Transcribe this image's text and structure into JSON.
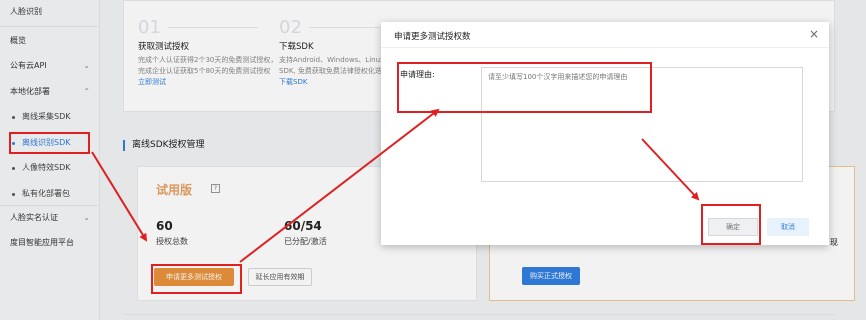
{
  "sidebar": {
    "items": [
      {
        "label": "人脸识别"
      },
      {
        "label": "概览"
      },
      {
        "label": "公有云API"
      },
      {
        "label": "本地化部署"
      },
      {
        "label": "离线采集SDK"
      },
      {
        "label": "离线识别SDK"
      },
      {
        "label": "人像特效SDK"
      },
      {
        "label": "私有化部署包"
      },
      {
        "label": "人脸实名认证"
      },
      {
        "label": "度目智能应用平台"
      }
    ]
  },
  "steps": [
    {
      "num": "01",
      "title": "获取测试授权",
      "desc": "完成个人认证获得2个30天的免费测试授权，完成企业认证获取5个80天的免费测试授权",
      "link": "立即测试"
    },
    {
      "num": "02",
      "title": "下载SDK",
      "desc": "支持Android、Windows、Linux多版本SDK, 免费获取免费法律授权化迭代",
      "link": "下载SDK"
    }
  ],
  "section": {
    "title": "离线SDK授权管理"
  },
  "trial": {
    "name": "试用版",
    "help": "?",
    "total_value": "60",
    "total_label": "授权总数",
    "used_value": "60/54",
    "used_label": "已分配/激活",
    "apply_btn": "申请更多测试授权",
    "extend_btn": "延长应用有效期"
  },
  "formal": {
    "partial_label": "现",
    "buy_btn": "购买正式授权"
  },
  "modal": {
    "title": "申请更多测试授权数",
    "close": "×",
    "field_label": "申请理由:",
    "placeholder": "请至少填写100个汉字用来描述您的申请理由",
    "ok_btn": "确定",
    "cancel_btn": "取消"
  },
  "colors": {
    "accent": "#2f7fe0",
    "trial": "#e8923c",
    "annotation": "#e02020"
  }
}
